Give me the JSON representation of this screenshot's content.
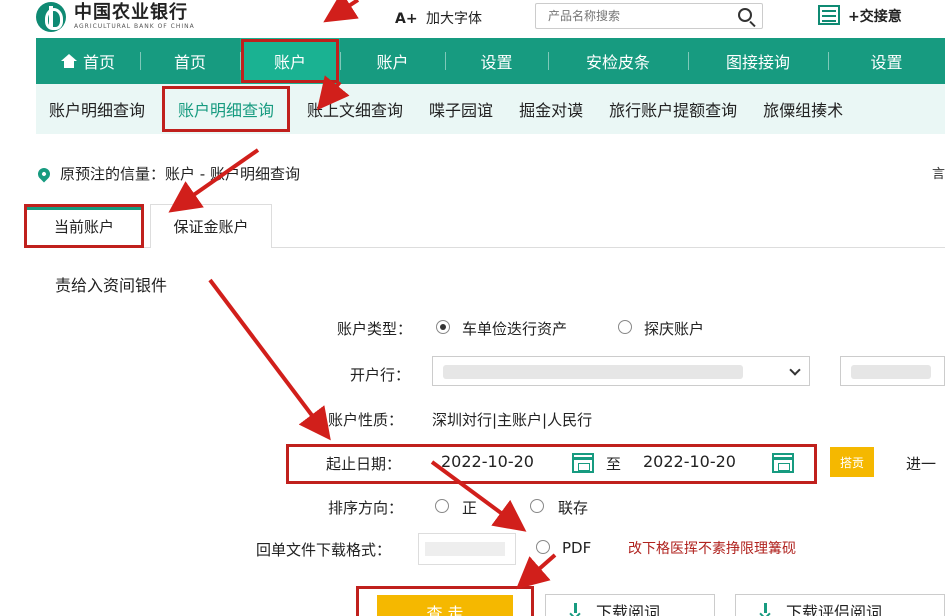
{
  "header": {
    "logo_cn": "中国农业银行",
    "logo_en": "AGRICULTURAL BANK OF CHINA",
    "font_size_label": "A+",
    "font_size_text": "加大字体",
    "search_placeholder": "产品名称搜索",
    "header_link": "+交接意"
  },
  "main_nav": {
    "items": [
      "首页",
      "首页",
      "账户",
      "账户",
      "设置",
      "安检皮条",
      "图接接询",
      "设置"
    ]
  },
  "sub_nav": {
    "items": [
      "账户明细查询",
      "账户明细查询",
      "账上文细查询",
      "喋子园谊",
      "掘金对谟",
      "旅行账户提额查询",
      "旅僳组揍术"
    ]
  },
  "breadcrumb": {
    "text": "原预注的信量：账户 - 账户明细查询",
    "edge": "言"
  },
  "tabs": {
    "current": "当前账户",
    "margin": "保证金账户"
  },
  "section_title": "责给入资间银件",
  "form": {
    "account_type_label": "账户类型：",
    "account_type_options": [
      "车单俭迭行资产",
      "探庆账户"
    ],
    "account_type_selected": 0,
    "open_bank_label": "开户行：",
    "account_nature_label": "账户性质：",
    "account_nature_value": "深圳対行|主账户|人民行",
    "date_label": "起止日期：",
    "date_from": "2022-10-20",
    "date_sep": "至",
    "date_to": "2022-10-20",
    "date_btn": "搭贡",
    "next_link": "进一",
    "sort_label": "排序方向：",
    "sort_options": [
      "正",
      "联存"
    ],
    "format_label": "回单文件下载格式：",
    "format_option": "PDF",
    "format_hint": "改下格医挥不素挣限理篝砚"
  },
  "buttons": {
    "query": "查 走",
    "download1": "下载阅词",
    "download2": "下载评侣阅词"
  },
  "colors": {
    "primary": "#179b80",
    "annotation_red": "#c0201d",
    "button_yellow": "#f5b800"
  }
}
